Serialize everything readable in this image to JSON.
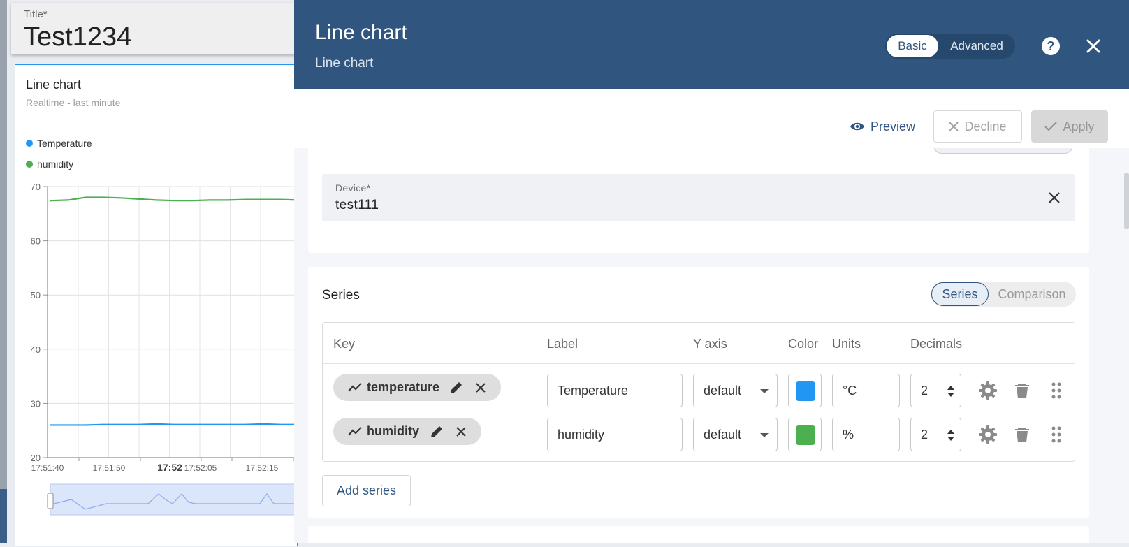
{
  "dashboard": {
    "title_label": "Title*",
    "title_value": "Test1234",
    "widget": {
      "title": "Line chart",
      "subtitle": "Realtime - last minute",
      "legend": [
        {
          "label": "Temperature",
          "color": "#2196f3"
        },
        {
          "label": "humidity",
          "color": "#4caf50"
        }
      ]
    }
  },
  "chart_data": {
    "type": "line",
    "title": "Line chart",
    "subtitle": "Realtime - last minute",
    "xlabel": "",
    "ylabel": "",
    "ylim": [
      20,
      70
    ],
    "y_ticks": [
      "70",
      "60",
      "50",
      "40",
      "30",
      "20"
    ],
    "x_ticks": [
      "17:51:40",
      "17:51:50",
      "17:52",
      "17:52:05",
      "17:52:15"
    ],
    "grid": true,
    "legend_position": "top-left",
    "x": [
      0,
      1,
      2,
      3,
      4,
      5,
      6,
      7,
      8,
      9,
      10,
      11,
      12,
      13,
      14
    ],
    "series": [
      {
        "name": "Temperature",
        "color": "#2196f3",
        "values": [
          26.0,
          26.0,
          26.0,
          26.1,
          26.1,
          26.1,
          26.2,
          26.1,
          26.1,
          26.1,
          26.1,
          26.1,
          26.2,
          26.1,
          26.1
        ]
      },
      {
        "name": "humidity",
        "color": "#4caf50",
        "values": [
          67.4,
          67.5,
          68.0,
          68.0,
          67.9,
          67.7,
          67.5,
          67.4,
          67.4,
          67.5,
          67.5,
          67.6,
          67.6,
          67.6,
          67.5
        ]
      }
    ]
  },
  "panel": {
    "title": "Line chart",
    "subtitle": "Line chart",
    "mode_basic": "Basic",
    "mode_advanced": "Advanced",
    "toolbar": {
      "preview": "Preview",
      "decline": "Decline",
      "apply": "Apply"
    },
    "device": {
      "label": "Device*",
      "value": "test111"
    },
    "series_section": {
      "title": "Series",
      "toggle_series": "Series",
      "toggle_comparison": "Comparison",
      "columns": {
        "key": "Key",
        "label": "Label",
        "y_axis": "Y axis",
        "color": "Color",
        "units": "Units",
        "decimals": "Decimals"
      },
      "rows": [
        {
          "key": "temperature",
          "label": "Temperature",
          "y_axis": "default",
          "color": "#2196f3",
          "units": "°C",
          "decimals": "2"
        },
        {
          "key": "humidity",
          "label": "humidity",
          "y_axis": "default",
          "color": "#4caf50",
          "units": "%",
          "decimals": "2"
        }
      ],
      "add_series": "Add series"
    }
  },
  "colors": {
    "header": "#305680",
    "accent": "#305680"
  },
  "icons": [
    "help-icon",
    "close-icon",
    "eye-icon",
    "x-icon",
    "check-icon",
    "timeseries-icon",
    "pencil-icon",
    "gear-icon",
    "trash-icon",
    "drag-handle-icon"
  ]
}
